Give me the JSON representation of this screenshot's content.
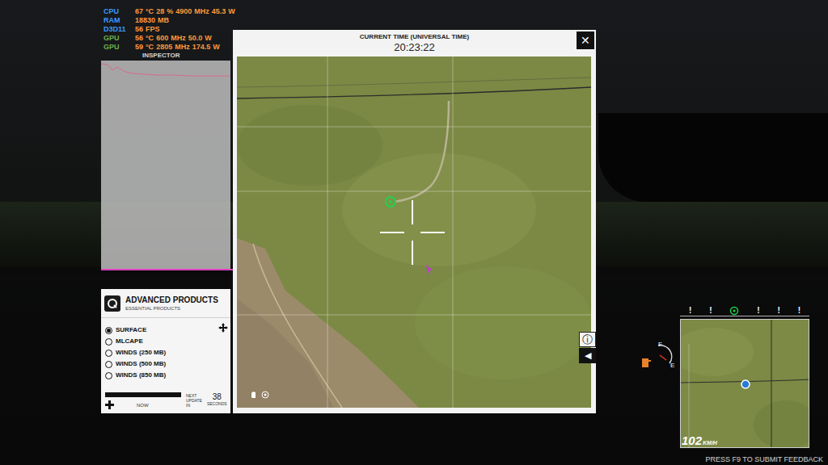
{
  "hud": {
    "stats": [
      {
        "label": "CPU",
        "values": [
          "67",
          "°C",
          "28",
          "%",
          "4900",
          "MHz",
          "45.3",
          "W"
        ],
        "color": "#3b9bff"
      },
      {
        "label": "RAM",
        "values": [
          "18830",
          "MB"
        ],
        "color": "#3b9bff"
      },
      {
        "label": "D3D11",
        "values": [
          "56",
          "FPS"
        ],
        "color": "#3b9bff"
      },
      {
        "label": "GPU",
        "values": [
          "56",
          "°C",
          "600",
          "MHz",
          "50.0",
          "W"
        ],
        "color": "#6ab04c"
      },
      {
        "label": "GPU",
        "values": [
          "59",
          "°C",
          "2805",
          "MHz",
          "174.5",
          "W"
        ],
        "color": "#6ab04c"
      }
    ],
    "inspector": "INSPECTOR"
  },
  "map_window": {
    "title": "CURRENT TIME (UNIVERSAL TIME)",
    "time": "20:23:22",
    "close": "✕",
    "info": "ⓘ",
    "collapse": "◀"
  },
  "products": {
    "title": "ADVANCED PRODUCTS",
    "subtitle": "ESSENTIAL PRODUCTS",
    "options": [
      {
        "label": "SURFACE",
        "selected": true
      },
      {
        "label": "MLCAPE",
        "selected": false
      },
      {
        "label": "WINDS (250 MB)",
        "selected": false
      },
      {
        "label": "WINDS (500 MB)",
        "selected": false
      },
      {
        "label": "WINDS (850 MB)",
        "selected": false
      }
    ],
    "timeline": {
      "level": 1,
      "label": "NOW"
    },
    "next_update": {
      "label": "NEXT UPDATE IN",
      "value": "38",
      "unit": "SECONDS"
    }
  },
  "compass": {
    "markers": [
      "!",
      "!",
      "!",
      "!",
      "!"
    ]
  },
  "dashboard": {
    "speed": "102",
    "unit": "KM/H",
    "fuel_full": "F",
    "fuel_empty": "E"
  },
  "feedback": "PRESS F9 TO SUBMIT FEEDBACK"
}
